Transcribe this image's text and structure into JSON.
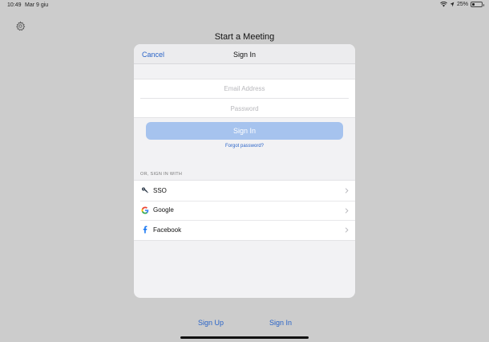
{
  "status_bar": {
    "time": "10:49",
    "date": "Mar 9 giu",
    "battery": "25%",
    "battery_level": 0.25
  },
  "page": {
    "title": "Start a Meeting",
    "sign_up_label": "Sign Up",
    "sign_in_label": "Sign In"
  },
  "modal": {
    "cancel_label": "Cancel",
    "title": "Sign In",
    "email_placeholder": "Email Address",
    "password_placeholder": "Password",
    "signin_button_label": "Sign In",
    "forgot_label": "Forgot password?",
    "or_label": "OR, SIGN IN WITH",
    "providers": [
      {
        "label": "SSO",
        "icon": "key-icon"
      },
      {
        "label": "Google",
        "icon": "google-icon"
      },
      {
        "label": "Facebook",
        "icon": "facebook-icon"
      }
    ]
  },
  "colors": {
    "accent": "#2a64c8",
    "button_disabled": "#a6c3ee",
    "backdrop": "#cccccc"
  }
}
